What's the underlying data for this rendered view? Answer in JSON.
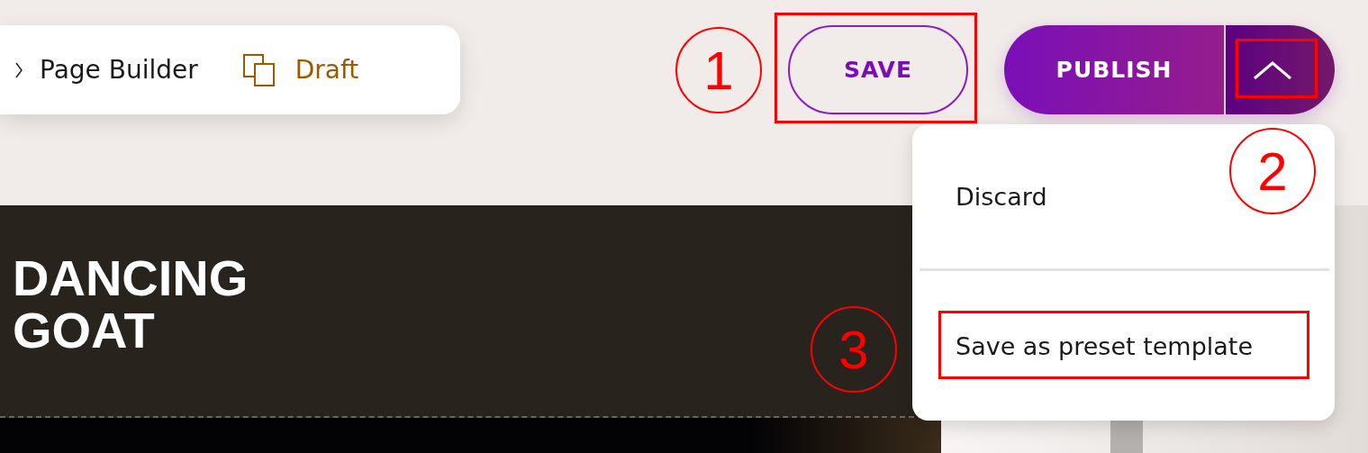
{
  "breadcrumb": {
    "items": [
      {
        "label": "Page Builder"
      }
    ],
    "status": {
      "label": "Draft"
    }
  },
  "actions": {
    "save": {
      "label": "SAVE"
    },
    "publish": {
      "label": "PUBLISH"
    },
    "menu_toggle": {
      "expanded": true
    }
  },
  "menu": {
    "items": [
      {
        "label": "Discard"
      },
      {
        "label": "Save as preset template"
      }
    ]
  },
  "preview": {
    "title": "DANCING GOAT"
  },
  "callouts": [
    {
      "number": "1"
    },
    {
      "number": "2"
    },
    {
      "number": "3"
    }
  ]
}
